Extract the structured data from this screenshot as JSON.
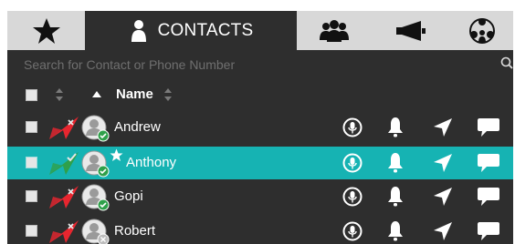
{
  "tabs": [
    {
      "name": "favorites",
      "icon": "star-icon",
      "label": ""
    },
    {
      "name": "contacts",
      "icon": "person-icon",
      "label": "CONTACTS",
      "active": true
    },
    {
      "name": "groups",
      "icon": "group-icon",
      "label": ""
    },
    {
      "name": "broadcast",
      "icon": "megaphone-icon",
      "label": ""
    },
    {
      "name": "network",
      "icon": "network-icon",
      "label": ""
    }
  ],
  "search": {
    "placeholder": "Search for Contact or Phone Number",
    "value": "",
    "icon": "search-icon"
  },
  "header": {
    "name_label": "Name",
    "sort": "ascending"
  },
  "contacts": [
    {
      "name": "Andrew",
      "status": "offline",
      "status_color": "#e8262f",
      "presence": "online",
      "favorite": false,
      "selected": false
    },
    {
      "name": "Anthony",
      "status": "online",
      "status_color": "#2fa04a",
      "presence": "online",
      "favorite": true,
      "selected": true
    },
    {
      "name": "Gopi",
      "status": "offline",
      "status_color": "#e8262f",
      "presence": "online",
      "favorite": false,
      "selected": false
    },
    {
      "name": "Robert",
      "status": "offline",
      "status_color": "#e8262f",
      "presence": "unavailable",
      "favorite": false,
      "selected": false
    }
  ],
  "row_actions": [
    "intercom-icon",
    "alert-bell-icon",
    "locate-arrow-icon",
    "message-icon"
  ],
  "colors": {
    "panel": "#2e2e2e",
    "selected_row": "#16b3b3",
    "inactive_tab": "#d8d8d8",
    "presence_online": "#2fa04a"
  }
}
